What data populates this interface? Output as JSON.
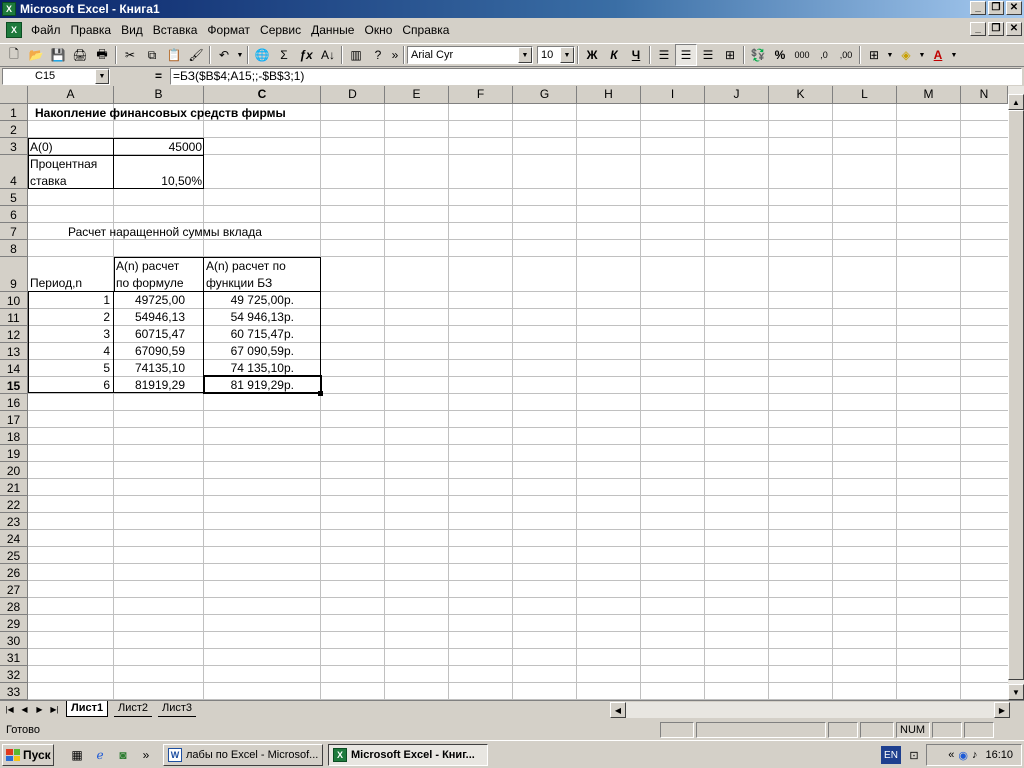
{
  "window": {
    "title": "Microsoft Excel - Книга1"
  },
  "menu": [
    "Файл",
    "Правка",
    "Вид",
    "Вставка",
    "Формат",
    "Сервис",
    "Данные",
    "Окно",
    "Справка"
  ],
  "toolbar": {
    "font_name": "Arial Cyr",
    "font_size": "10",
    "bold": "Ж",
    "italic": "К",
    "underline": "Ч",
    "percent": "%",
    "thousands": "000",
    "inc_dec": ",0",
    "dec_dec": ",00"
  },
  "formula_bar": {
    "name_box": "C15",
    "eq": "=",
    "formula": "=БЗ($B$4;A15;;-$B$3;1)"
  },
  "columns": [
    "A",
    "B",
    "C",
    "D",
    "E",
    "F",
    "G",
    "H",
    "I",
    "J",
    "K",
    "L",
    "M",
    "N"
  ],
  "rows": [
    "1",
    "2",
    "3",
    "4",
    "5",
    "6",
    "7",
    "8",
    "9",
    "10",
    "11",
    "12",
    "13",
    "14",
    "15",
    "16",
    "17",
    "18",
    "19",
    "20",
    "21",
    "22",
    "23",
    "24",
    "25",
    "26",
    "27",
    "28",
    "29",
    "30",
    "31",
    "32",
    "33"
  ],
  "cells": {
    "A1": "Накопление финансовых средств фирмы",
    "A3": "A(0)",
    "B3": "45000",
    "A4a": "Процентная",
    "A4b": "ставка",
    "B4": "10,50%",
    "A7": "Расчет наращенной суммы вклада",
    "B9a": "A(n) расчет",
    "B9b": "по формуле",
    "C9a": "A(n) расчет по",
    "C9b": "функции БЗ",
    "A9": "Период,n",
    "table": [
      {
        "n": "1",
        "b": "49725,00",
        "c": "49 725,00р."
      },
      {
        "n": "2",
        "b": "54946,13",
        "c": "54 946,13р."
      },
      {
        "n": "3",
        "b": "60715,47",
        "c": "60 715,47р."
      },
      {
        "n": "4",
        "b": "67090,59",
        "c": "67 090,59р."
      },
      {
        "n": "5",
        "b": "74135,10",
        "c": "74 135,10р."
      },
      {
        "n": "6",
        "b": "81919,29",
        "c": "81 919,29р."
      }
    ]
  },
  "sheets": [
    "Лист1",
    "Лист2",
    "Лист3"
  ],
  "status": {
    "ready": "Готово",
    "num": "NUM"
  },
  "taskbar": {
    "start": "Пуск",
    "task1": "лабы по Excel - Microsof...",
    "task2": "Microsoft Excel - Книг...",
    "lang": "EN",
    "time": "16:10",
    "more": "»",
    "tray_more": "«"
  }
}
